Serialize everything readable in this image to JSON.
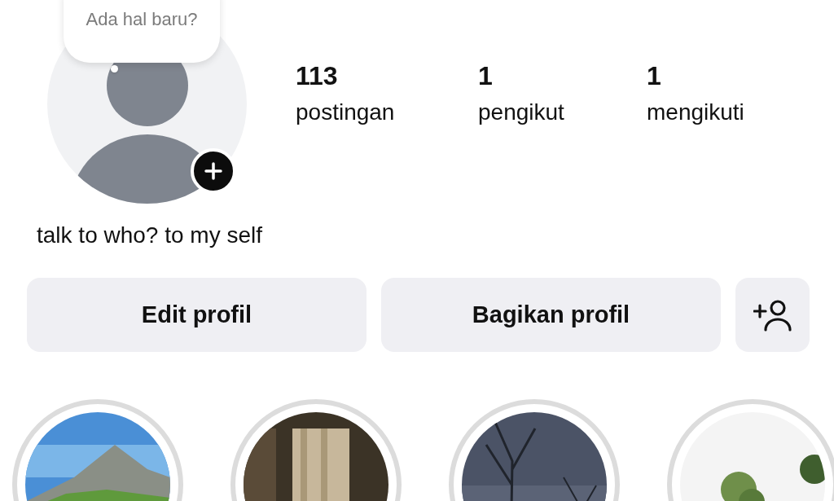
{
  "note_bubble": {
    "text": "Ada hal baru?"
  },
  "stats": [
    {
      "value": "113",
      "label": "postingan"
    },
    {
      "value": "1",
      "label": "pengikut"
    },
    {
      "value": "1",
      "label": "mengikuti"
    }
  ],
  "bio": "talk to who? to my self",
  "buttons": [
    {
      "kind": "text",
      "label": "Edit profil"
    },
    {
      "kind": "text",
      "label": "Bagikan profil"
    },
    {
      "kind": "add-person"
    }
  ]
}
